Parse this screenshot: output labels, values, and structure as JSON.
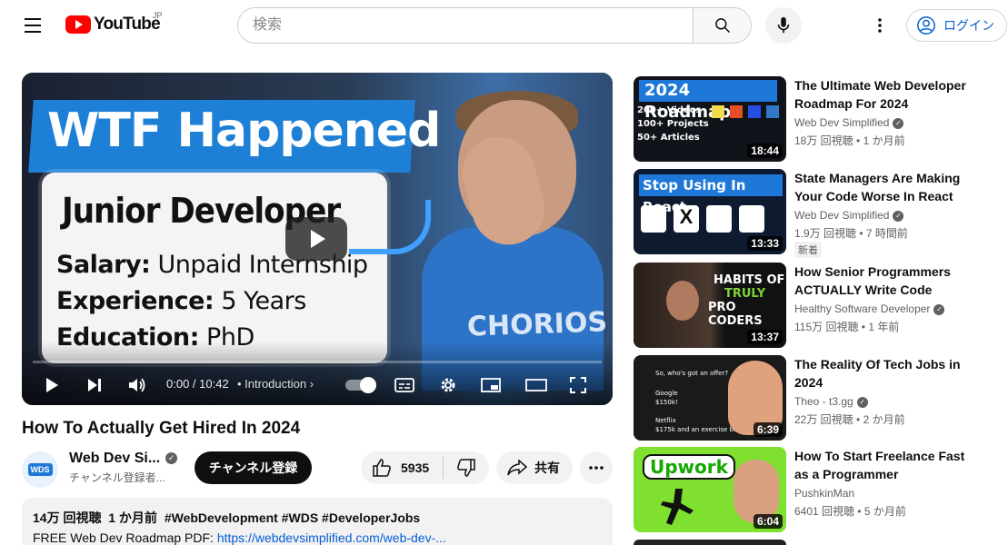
{
  "header": {
    "logo_text": "YouTube",
    "country_code": "JP",
    "search_placeholder": "検索",
    "login_label": "ログイン"
  },
  "player": {
    "thumbnail": {
      "banner": "WTF Happened",
      "card_title": "Junior Developer",
      "lines": [
        {
          "label": "Salary:",
          "value": "Unpaid Internship"
        },
        {
          "label": "Experience:",
          "value": "5 Years"
        },
        {
          "label": "Education:",
          "value": "PhD"
        }
      ],
      "shirt_text": "CHORIOS"
    },
    "time_current": "0:00",
    "time_total": "10:42",
    "chapter": "• Introduction",
    "progress": 0
  },
  "video": {
    "title": "How To Actually Get Hired In 2024",
    "channel_name": "Web Dev Si...",
    "channel_badge": "WDS",
    "subscribers": "チャンネル登録者...",
    "subscribe_label": "チャンネル登録",
    "likes": "5935",
    "share_label": "共有",
    "views": "14万 回視聴",
    "date": "1 か月前",
    "tags": "#WebDevelopment #WDS #DeveloperJobs",
    "desc_prefix": "FREE Web Dev Roadmap PDF: ",
    "desc_link": "https://webdevsimplified.com/web-dev-..."
  },
  "recommendations": [
    {
      "title": "The Ultimate Web Developer Roadmap For 2024",
      "channel": "Web Dev Simplified",
      "verified": true,
      "views": "18万 回視聴",
      "age": "1 か月前",
      "duration": "18:44",
      "thumb_text": "2024 Roadmap",
      "thumb_sub": [
        "200+ Videos",
        "100+ Projects",
        "50+ Articles"
      ],
      "badge": ""
    },
    {
      "title": "State Managers Are Making Your Code Worse In React",
      "channel": "Web Dev Simplified",
      "verified": true,
      "views": "1.9万 回視聴",
      "age": "7 時間前",
      "duration": "13:33",
      "thumb_text": "Stop Using In React",
      "thumb_sub": [],
      "badge": "新着"
    },
    {
      "title": "How Senior Programmers ACTUALLY Write Code",
      "channel": "Healthy Software Developer",
      "verified": true,
      "views": "115万 回視聴",
      "age": "1 年前",
      "duration": "13:37",
      "thumb_text": "HABITS OF",
      "thumb_sub": [
        "TRULY",
        "PRO CODERS"
      ],
      "badge": ""
    },
    {
      "title": "The Reality Of Tech Jobs in 2024",
      "channel": "Theo - t3.gg",
      "verified": true,
      "views": "22万 回視聴",
      "age": "2 か月前",
      "duration": "6:39",
      "thumb_text": "So, who's got an offer?",
      "thumb_sub": [
        "Google",
        "$150k!",
        "Netflix",
        "$175k and an exercise ball"
      ],
      "badge": ""
    },
    {
      "title": "How To Start Freelance Fast as a Programmer",
      "channel": "PushkinMan",
      "verified": false,
      "views": "6401 回視聴",
      "age": "5 か月前",
      "duration": "6:04",
      "thumb_text": "Upwork",
      "thumb_sub": [],
      "badge": ""
    }
  ]
}
